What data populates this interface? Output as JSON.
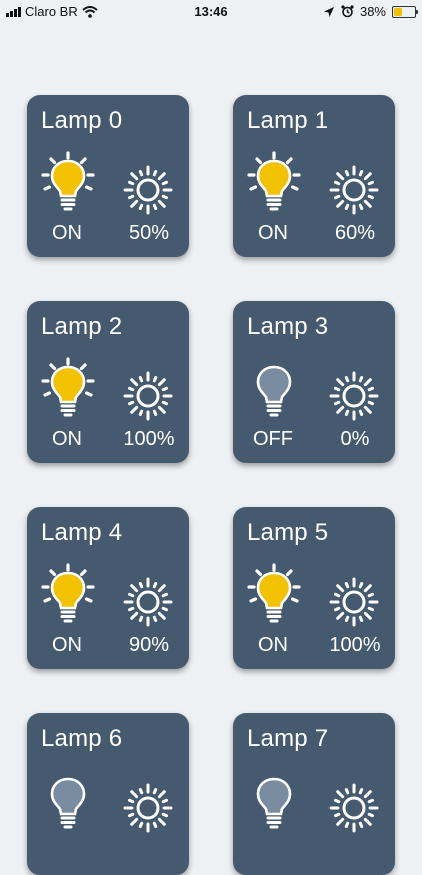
{
  "status_bar": {
    "carrier": "Claro BR",
    "time": "13:46",
    "battery_percent": "38%",
    "battery_level": 0.38
  },
  "colors": {
    "background": "#eef1f4",
    "card": "#455a6f",
    "bulb_on": "#f2c200",
    "bulb_off": "#7a8ca0",
    "text": "#ffffff"
  },
  "lamps": [
    {
      "name": "Lamp 0",
      "state": "ON",
      "brightness": "50%"
    },
    {
      "name": "Lamp 1",
      "state": "ON",
      "brightness": "60%"
    },
    {
      "name": "Lamp 2",
      "state": "ON",
      "brightness": "100%"
    },
    {
      "name": "Lamp 3",
      "state": "OFF",
      "brightness": "0%"
    },
    {
      "name": "Lamp 4",
      "state": "ON",
      "brightness": "90%"
    },
    {
      "name": "Lamp 5",
      "state": "ON",
      "brightness": "100%"
    },
    {
      "name": "Lamp 6",
      "state": "",
      "brightness": ""
    },
    {
      "name": "Lamp 7",
      "state": "",
      "brightness": ""
    }
  ]
}
